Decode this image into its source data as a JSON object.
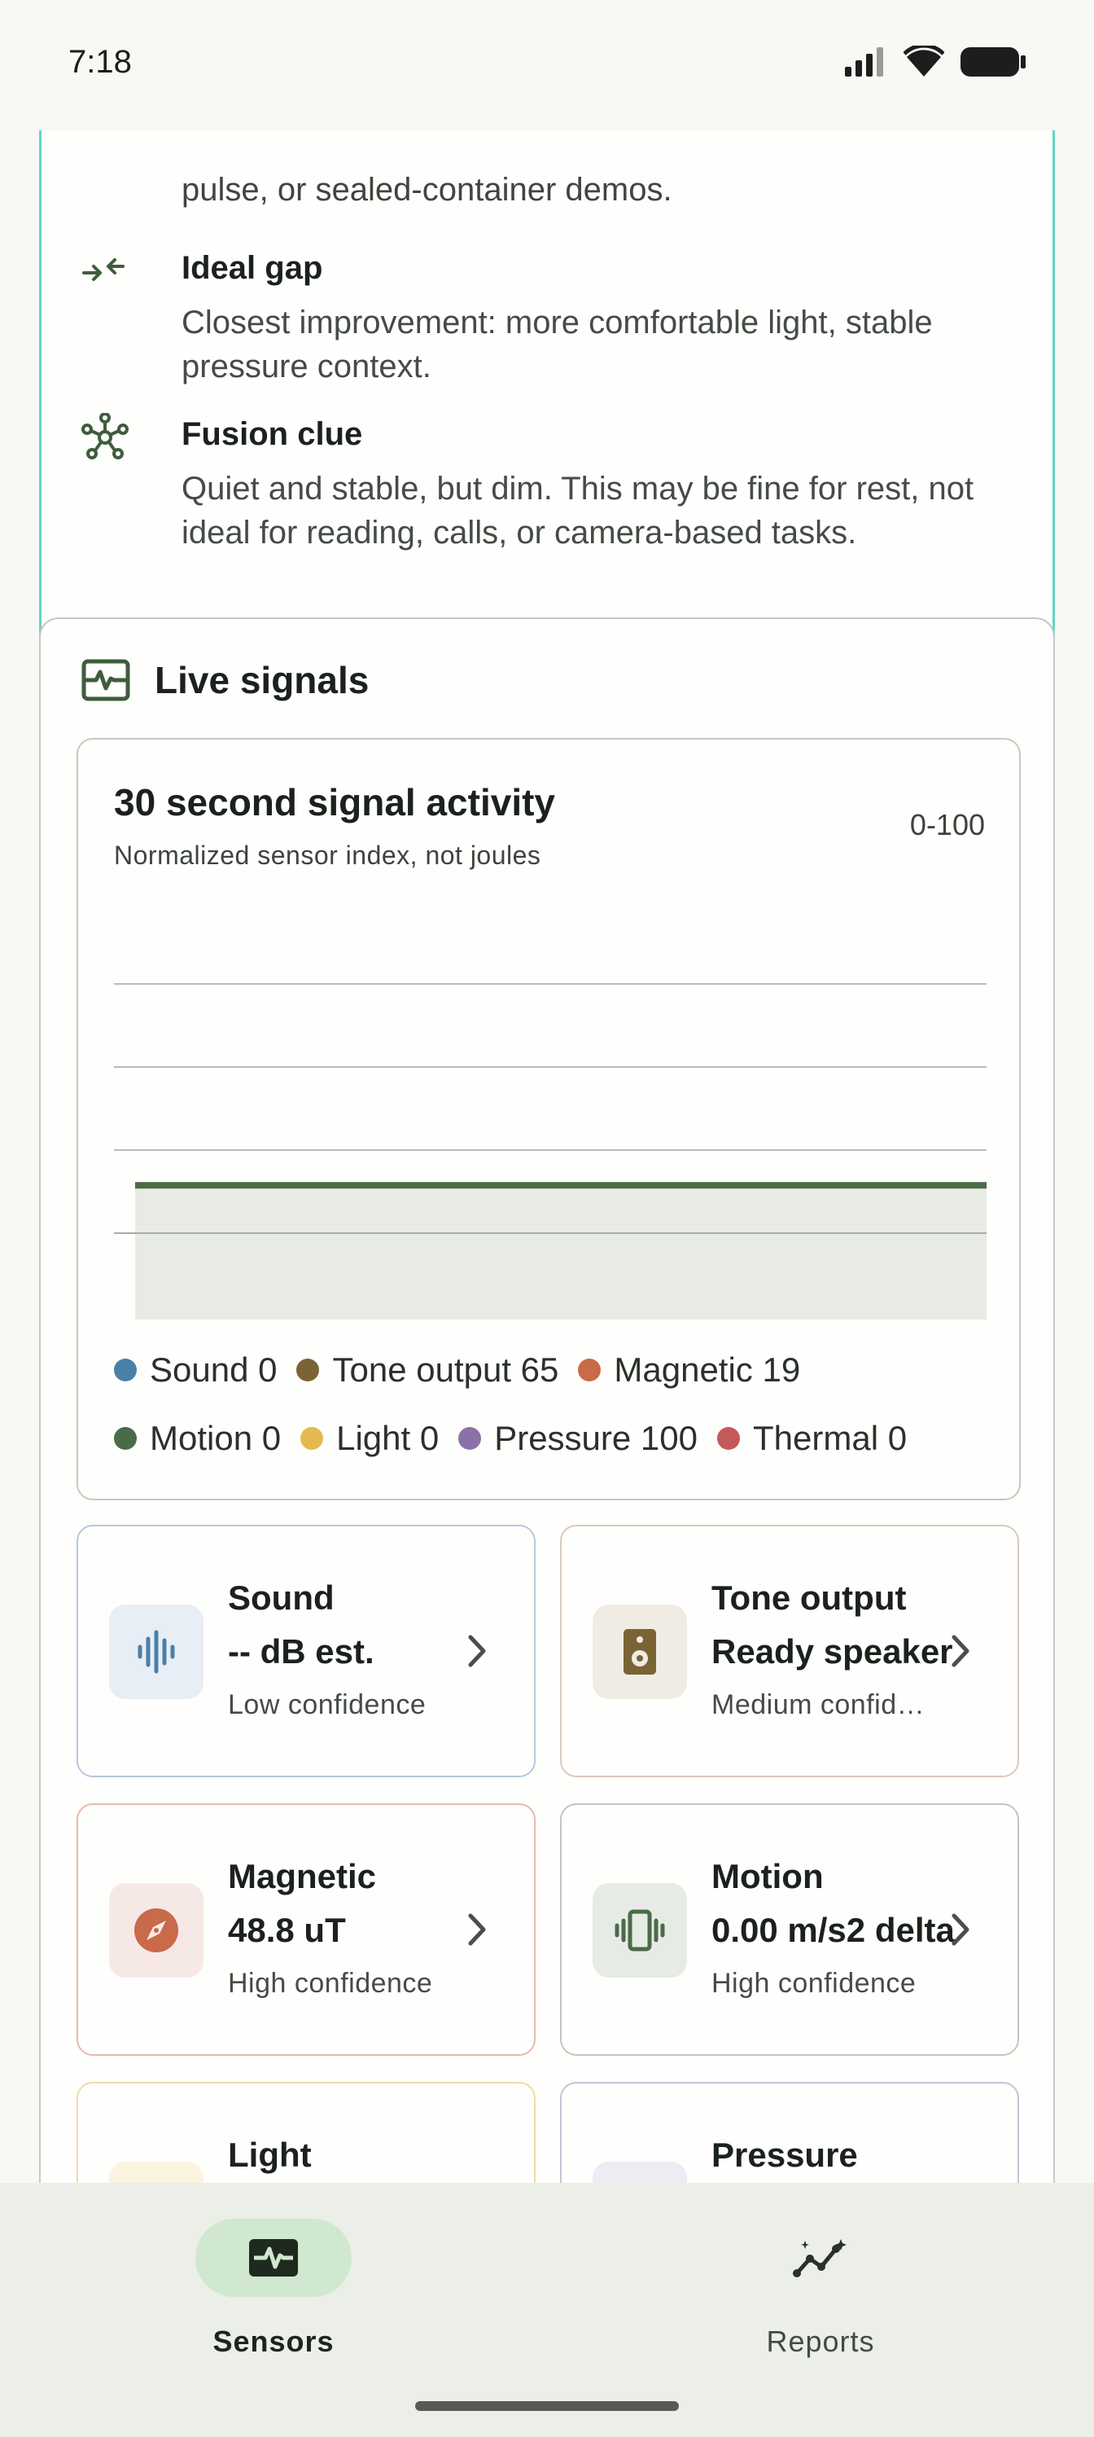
{
  "status_bar": {
    "time": "7:18"
  },
  "insight": {
    "top_text": "pulse, or sealed-container demos.",
    "rows": [
      {
        "title": "Ideal gap",
        "body": "Closest improvement: more comfortable light, stable pressure context.",
        "icon": "compress-arrows-icon"
      },
      {
        "title": "Fusion clue",
        "body": "Quiet and stable, but dim. This may be fine for rest, not ideal for reading, calls, or camera-based tasks.",
        "icon": "hub-icon"
      }
    ],
    "border_color": "#64d4c4"
  },
  "live_signals": {
    "title": "Live signals",
    "icon": "monitor-heart-icon",
    "chart": {
      "title": "30 second signal activity",
      "subtitle": "Normalized sensor index, not joules",
      "range_label": "0-100"
    },
    "legend": [
      {
        "label": "Sound 0",
        "color": "#4a7fa8"
      },
      {
        "label": "Tone output 65",
        "color": "#7a6436"
      },
      {
        "label": "Magnetic 19",
        "color": "#c96a4a"
      },
      {
        "label": "Motion 0",
        "color": "#4a6b47"
      },
      {
        "label": "Light 0",
        "color": "#e5b850"
      },
      {
        "label": "Pressure 100",
        "color": "#8a72a8"
      },
      {
        "label": "Thermal 0",
        "color": "#c45a58"
      }
    ],
    "tiles": [
      {
        "title": "Sound",
        "value": "-- dB est.",
        "confidence": "Low confidence",
        "icon": "graphic-eq-icon",
        "accent": "#4a7fa8",
        "icon_bg": "#e8eef5",
        "border": "#b4c9de"
      },
      {
        "title": "Tone output",
        "value": "Ready speaker",
        "confidence": "Medium confidence",
        "icon": "speaker-icon",
        "accent": "#7a6436",
        "icon_bg": "#f0ece4",
        "border": "#d9c9bd"
      },
      {
        "title": "Magnetic",
        "value": "48.8 uT",
        "confidence": "High confidence",
        "icon": "compass-icon",
        "accent": "#c96a4a",
        "icon_bg": "#f6e9e5",
        "border": "#e7b9aa"
      },
      {
        "title": "Motion",
        "value": "0.00 m/s2 delta",
        "confidence": "High confidence",
        "icon": "vibration-icon",
        "accent": "#4a6b47",
        "icon_bg": "#e7ebe6",
        "border": "#c1c6c0"
      },
      {
        "title": "Light",
        "value": "",
        "confidence": "",
        "icon": "light-icon",
        "accent": "#e5b850",
        "icon_bg": "#fbf3df",
        "border": "#f1dcaa"
      },
      {
        "title": "Pressure",
        "value": "",
        "confidence": "",
        "icon": "pressure-icon",
        "accent": "#8a72a8",
        "icon_bg": "#eeebf2",
        "border": "#c9c1d9"
      }
    ]
  },
  "chart_data": {
    "type": "area",
    "title": "30 second signal activity",
    "subtitle": "Normalized sensor index, not joules",
    "ylim": [
      0,
      100
    ],
    "grid": true,
    "series": [
      {
        "name": "Motion",
        "values": [
          40,
          40,
          40,
          40,
          40,
          40,
          40,
          40,
          40,
          40,
          40,
          40,
          40,
          40,
          40,
          40,
          40,
          40,
          40,
          40,
          40,
          40,
          40,
          40,
          40,
          40,
          40,
          40,
          40,
          40
        ]
      }
    ],
    "legend_position": "bottom"
  },
  "bottom_nav": {
    "items": [
      {
        "label": "Sensors",
        "icon": "monitor-heart-icon",
        "active": true
      },
      {
        "label": "Reports",
        "icon": "insights-icon",
        "active": false
      }
    ]
  }
}
